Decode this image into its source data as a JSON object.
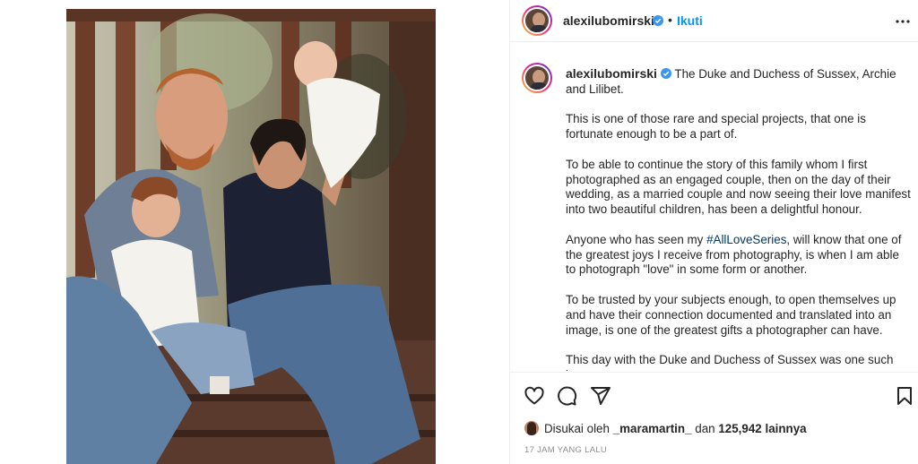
{
  "post": {
    "author": "alexilubomirski",
    "follow_dot": "•",
    "follow_label": "Ikuti",
    "more_icon": "more-horizontal-icon"
  },
  "caption": {
    "author": "alexilubomirski",
    "lead": "The Duke and Duchess of Sussex, Archie and Lilibet.",
    "p1": "This is one of those rare and special projects, that one is fortunate enough to be a part of.",
    "p2": "To be able to continue the story of this family whom I first photographed as an engaged couple, then on the day of their wedding, as a married couple and now seeing their love manifest into two beautiful children, has been a delightful honour.",
    "p3_before": "Anyone who has seen my ",
    "p3_hashtag": "#AllLoveSeries",
    "p3_after": ", will know that one of the greatest joys I receive from photography, is when I am able to photograph \"love\" in some form or another.",
    "p4": "To be trusted by your subjects enough, to open themselves up and have their connection documented and translated into an image, is one of the greatest gifts a photographer can have.",
    "p5": "This day with the Duke and Duchess of Sussex was one such joyous"
  },
  "actions": {
    "like_icon": "heart-icon",
    "comment_icon": "comment-icon",
    "share_icon": "share-icon",
    "save_icon": "bookmark-icon"
  },
  "likes": {
    "prefix": "Disukai oleh",
    "user": "_maramartin_",
    "middle": "dan",
    "count": "125,942",
    "suffix": "lainnya"
  },
  "timestamp": "17 jam yang lalu",
  "colors": {
    "link": "#0095f6",
    "hashtag": "#00376b",
    "verified": "#3897f0",
    "muted": "#8e8e8e"
  }
}
